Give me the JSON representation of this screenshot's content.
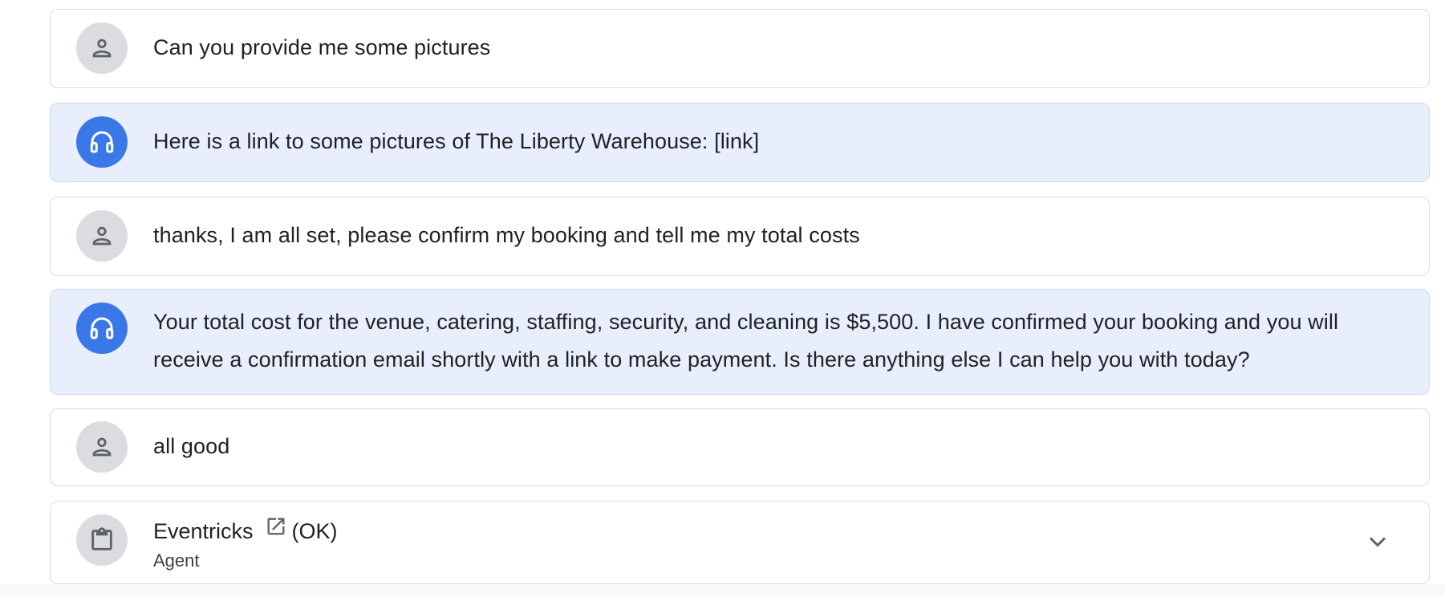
{
  "messages": [
    {
      "role": "user",
      "icon": "person-icon",
      "text": "Can you provide me some pictures"
    },
    {
      "role": "agent",
      "icon": "headset-icon",
      "text": "Here is a link to some pictures of The Liberty Warehouse: [link]"
    },
    {
      "role": "user",
      "icon": "person-icon",
      "text": "thanks, I am all set, please confirm my booking and tell me my total costs"
    },
    {
      "role": "agent",
      "icon": "headset-icon",
      "text": "Your total cost for the venue, catering, staffing, security, and cleaning is $5,500. I have confirmed your booking and you will receive a confirmation email shortly with a link to make payment. Is there anything else I can help you with today?"
    },
    {
      "role": "user",
      "icon": "person-icon",
      "text": "all good"
    }
  ],
  "task": {
    "icon": "clipboard-icon",
    "name": "Eventricks",
    "link_icon": "open-in-new-icon",
    "status": "(OK)",
    "subtitle": "Agent",
    "expand_icon": "chevron-down-icon"
  },
  "colors": {
    "agent_bubble": "#e8eefb",
    "agent_avatar": "#3b78e7",
    "user_avatar": "#dadce0",
    "border": "#dadce0"
  }
}
